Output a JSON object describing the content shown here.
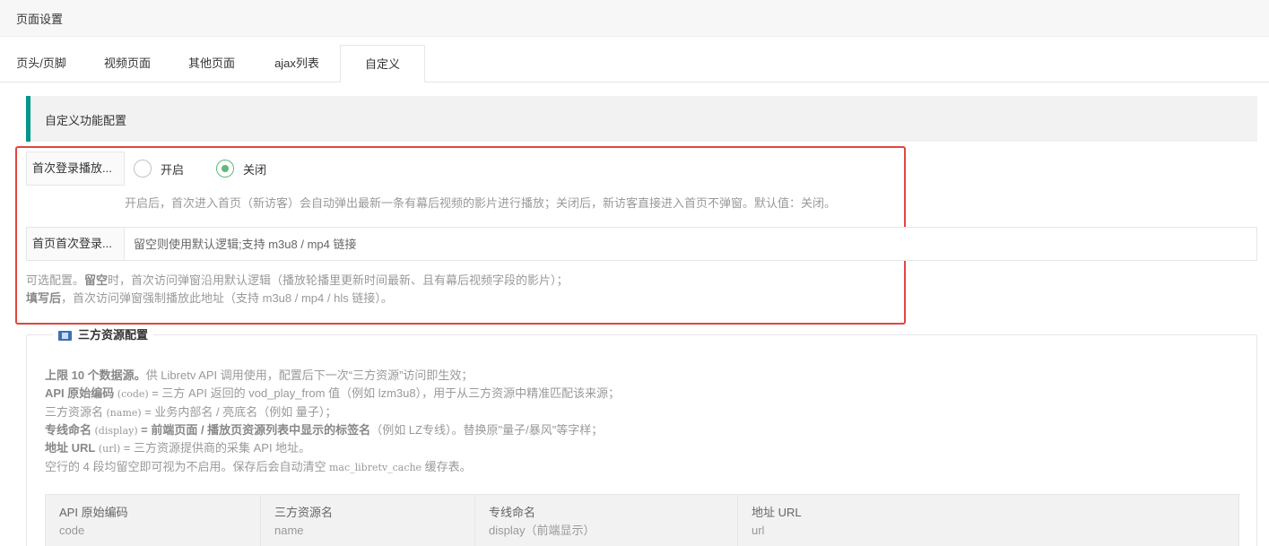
{
  "header": {
    "title": "页面设置"
  },
  "tabs": [
    {
      "label": "页头/页脚"
    },
    {
      "label": "视频页面"
    },
    {
      "label": "其他页面"
    },
    {
      "label": "ajax列表"
    },
    {
      "label": "自定义",
      "active": true
    }
  ],
  "section": {
    "title": "自定义功能配置"
  },
  "first_login_play": {
    "label": "首次登录播放...",
    "options": [
      "开启",
      "关闭"
    ],
    "selected": "关闭",
    "hint": "开启后，首次进入首页（新访客）会自动弹出最新一条有幕后视频的影片进行播放；关闭后，新访客直接进入首页不弹窗。默认值：关闭。"
  },
  "first_login_url": {
    "label": "首页首次登录...",
    "placeholder": "留空则使用默认逻辑;支持 m3u8 / mp4 链接",
    "hint_line1_prefix": "可选配置。",
    "hint_line1_bold": "留空",
    "hint_line1_rest": "时，首次访问弹窗沿用默认逻辑（播放轮播里更新时间最新、且有幕后视频字段的影片）；",
    "hint_line2_bold": "填写后",
    "hint_line2_rest": "，首次访问弹窗强制播放此地址（支持 m3u8 / mp4 / hls 链接）。"
  },
  "third_party": {
    "title": "三方资源配置",
    "desc": [
      {
        "bold": "上限 10 个数据源。",
        "text": "供 Libretv API 调用使用，配置后下一次“三方资源”访问即生效；"
      },
      {
        "bold": "API 原始编码",
        "code": " (code) ",
        "text": "= 三方 API 返回的 vod_play_from 值（例如 lzm3u8），用于从三方资源中精准匹配该来源；"
      },
      {
        "bold": "",
        "text1": "三方资源名",
        "code": " (name) ",
        "text": "= 业务内部名 / 亮底名（例如 量子）；"
      },
      {
        "bold": "专线命名",
        "code": " (display) ",
        "bold2": "= 前端页面 / 播放页资源列表中显示的标签名",
        "text": "（例如 LZ专线）。替换原\"量子/暴风\"等字样；"
      },
      {
        "bold": "地址 URL",
        "code": " (url) ",
        "text": "= 三方资源提供商的采集 API 地址。"
      },
      {
        "bold": "",
        "text1": "空行的 4 段均留空即可视为不启用。保存后会自动清空",
        "code": " mac_libretv_cache ",
        "text": "缓存表。"
      }
    ],
    "table_headers": [
      {
        "main": "API 原始编码",
        "sub": "code"
      },
      {
        "main": "三方资源名",
        "sub": "name"
      },
      {
        "main": "专线命名",
        "sub": "display（前端显示）"
      },
      {
        "main": "地址 URL",
        "sub": "url"
      }
    ]
  },
  "colors": {
    "accent": "#009688",
    "radio_checked": "#5fb878",
    "highlight": "#e0453f"
  }
}
